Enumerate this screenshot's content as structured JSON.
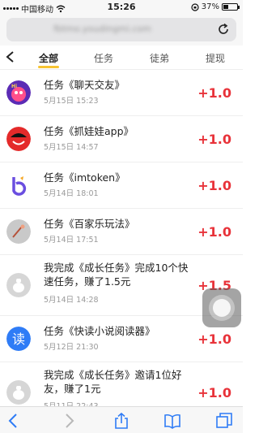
{
  "status_bar": {
    "carrier": "中国移动",
    "time": "15:26",
    "battery": "37%",
    "battery_level": 0.37
  },
  "url_bar": {
    "url": "fbtmo.youdingmi.com"
  },
  "tabs": [
    {
      "label": "全部",
      "active": true
    },
    {
      "label": "任务",
      "active": false
    },
    {
      "label": "徒弟",
      "active": false
    },
    {
      "label": "提现",
      "active": false
    }
  ],
  "records": [
    {
      "title": "任务《聊天交友》",
      "date": "5月15日 15:23",
      "amount": "+1.0",
      "icon": "chat-app-icon"
    },
    {
      "title": "任务《抓娃娃app》",
      "date": "5月15日 14:57",
      "amount": "+1.0",
      "icon": "claw-machine-app-icon"
    },
    {
      "title": "任务《imtoken》",
      "date": "5月14日 18:01",
      "amount": "+1.0",
      "icon": "imtoken-app-icon"
    },
    {
      "title": "任务《百家乐玩法》",
      "date": "5月14日 17:51",
      "amount": "+1.0",
      "icon": "baccarat-app-icon"
    },
    {
      "title": "我完成《成长任务》完成10个快速任务，赚了1.5元",
      "date": "5月14日 14:28",
      "amount": "+1.5",
      "icon": "growth-task-icon"
    },
    {
      "title": "任务《快读小说阅读器》",
      "date": "5月12日 21:30",
      "amount": "+1.0",
      "icon": "reader-app-icon"
    },
    {
      "title": "我完成《成长任务》邀请1位好友，赚了1元",
      "date": "5月11日 22:43",
      "amount": "+1.0",
      "icon": "growth-task-icon"
    }
  ],
  "colors": {
    "amount": "#e8333a",
    "tab_indicator": "#f7c432",
    "ios_blue": "#2f7cf6"
  }
}
